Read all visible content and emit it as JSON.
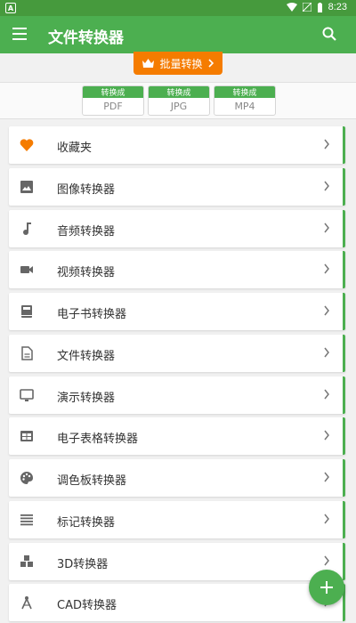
{
  "statusbar": {
    "time": "8:23",
    "left_badge": "A"
  },
  "appbar": {
    "title": "文件转换器"
  },
  "batch": {
    "label": "批量转换"
  },
  "quick": [
    {
      "top": "转换成",
      "bottom": "PDF"
    },
    {
      "top": "转换成",
      "bottom": "JPG"
    },
    {
      "top": "转换成",
      "bottom": "MP4"
    }
  ],
  "items": [
    {
      "label": "收藏夹",
      "icon": "heart-icon"
    },
    {
      "label": "图像转换器",
      "icon": "image-icon"
    },
    {
      "label": "音频转换器",
      "icon": "music-note-icon"
    },
    {
      "label": "视频转换器",
      "icon": "video-camera-icon"
    },
    {
      "label": "电子书转换器",
      "icon": "book-icon"
    },
    {
      "label": "文件转换器",
      "icon": "document-icon"
    },
    {
      "label": "演示转换器",
      "icon": "monitor-icon"
    },
    {
      "label": "电子表格转换器",
      "icon": "table-icon"
    },
    {
      "label": "调色板转换器",
      "icon": "palette-icon"
    },
    {
      "label": "标记转换器",
      "icon": "markup-lines-icon"
    },
    {
      "label": "3D转换器",
      "icon": "cubes-icon"
    },
    {
      "label": "CAD转换器",
      "icon": "cad-compass-icon"
    }
  ],
  "colors": {
    "primary": "#4caf50",
    "status": "#469a3d",
    "accent": "#f57c00",
    "heart": "#f57c00"
  }
}
